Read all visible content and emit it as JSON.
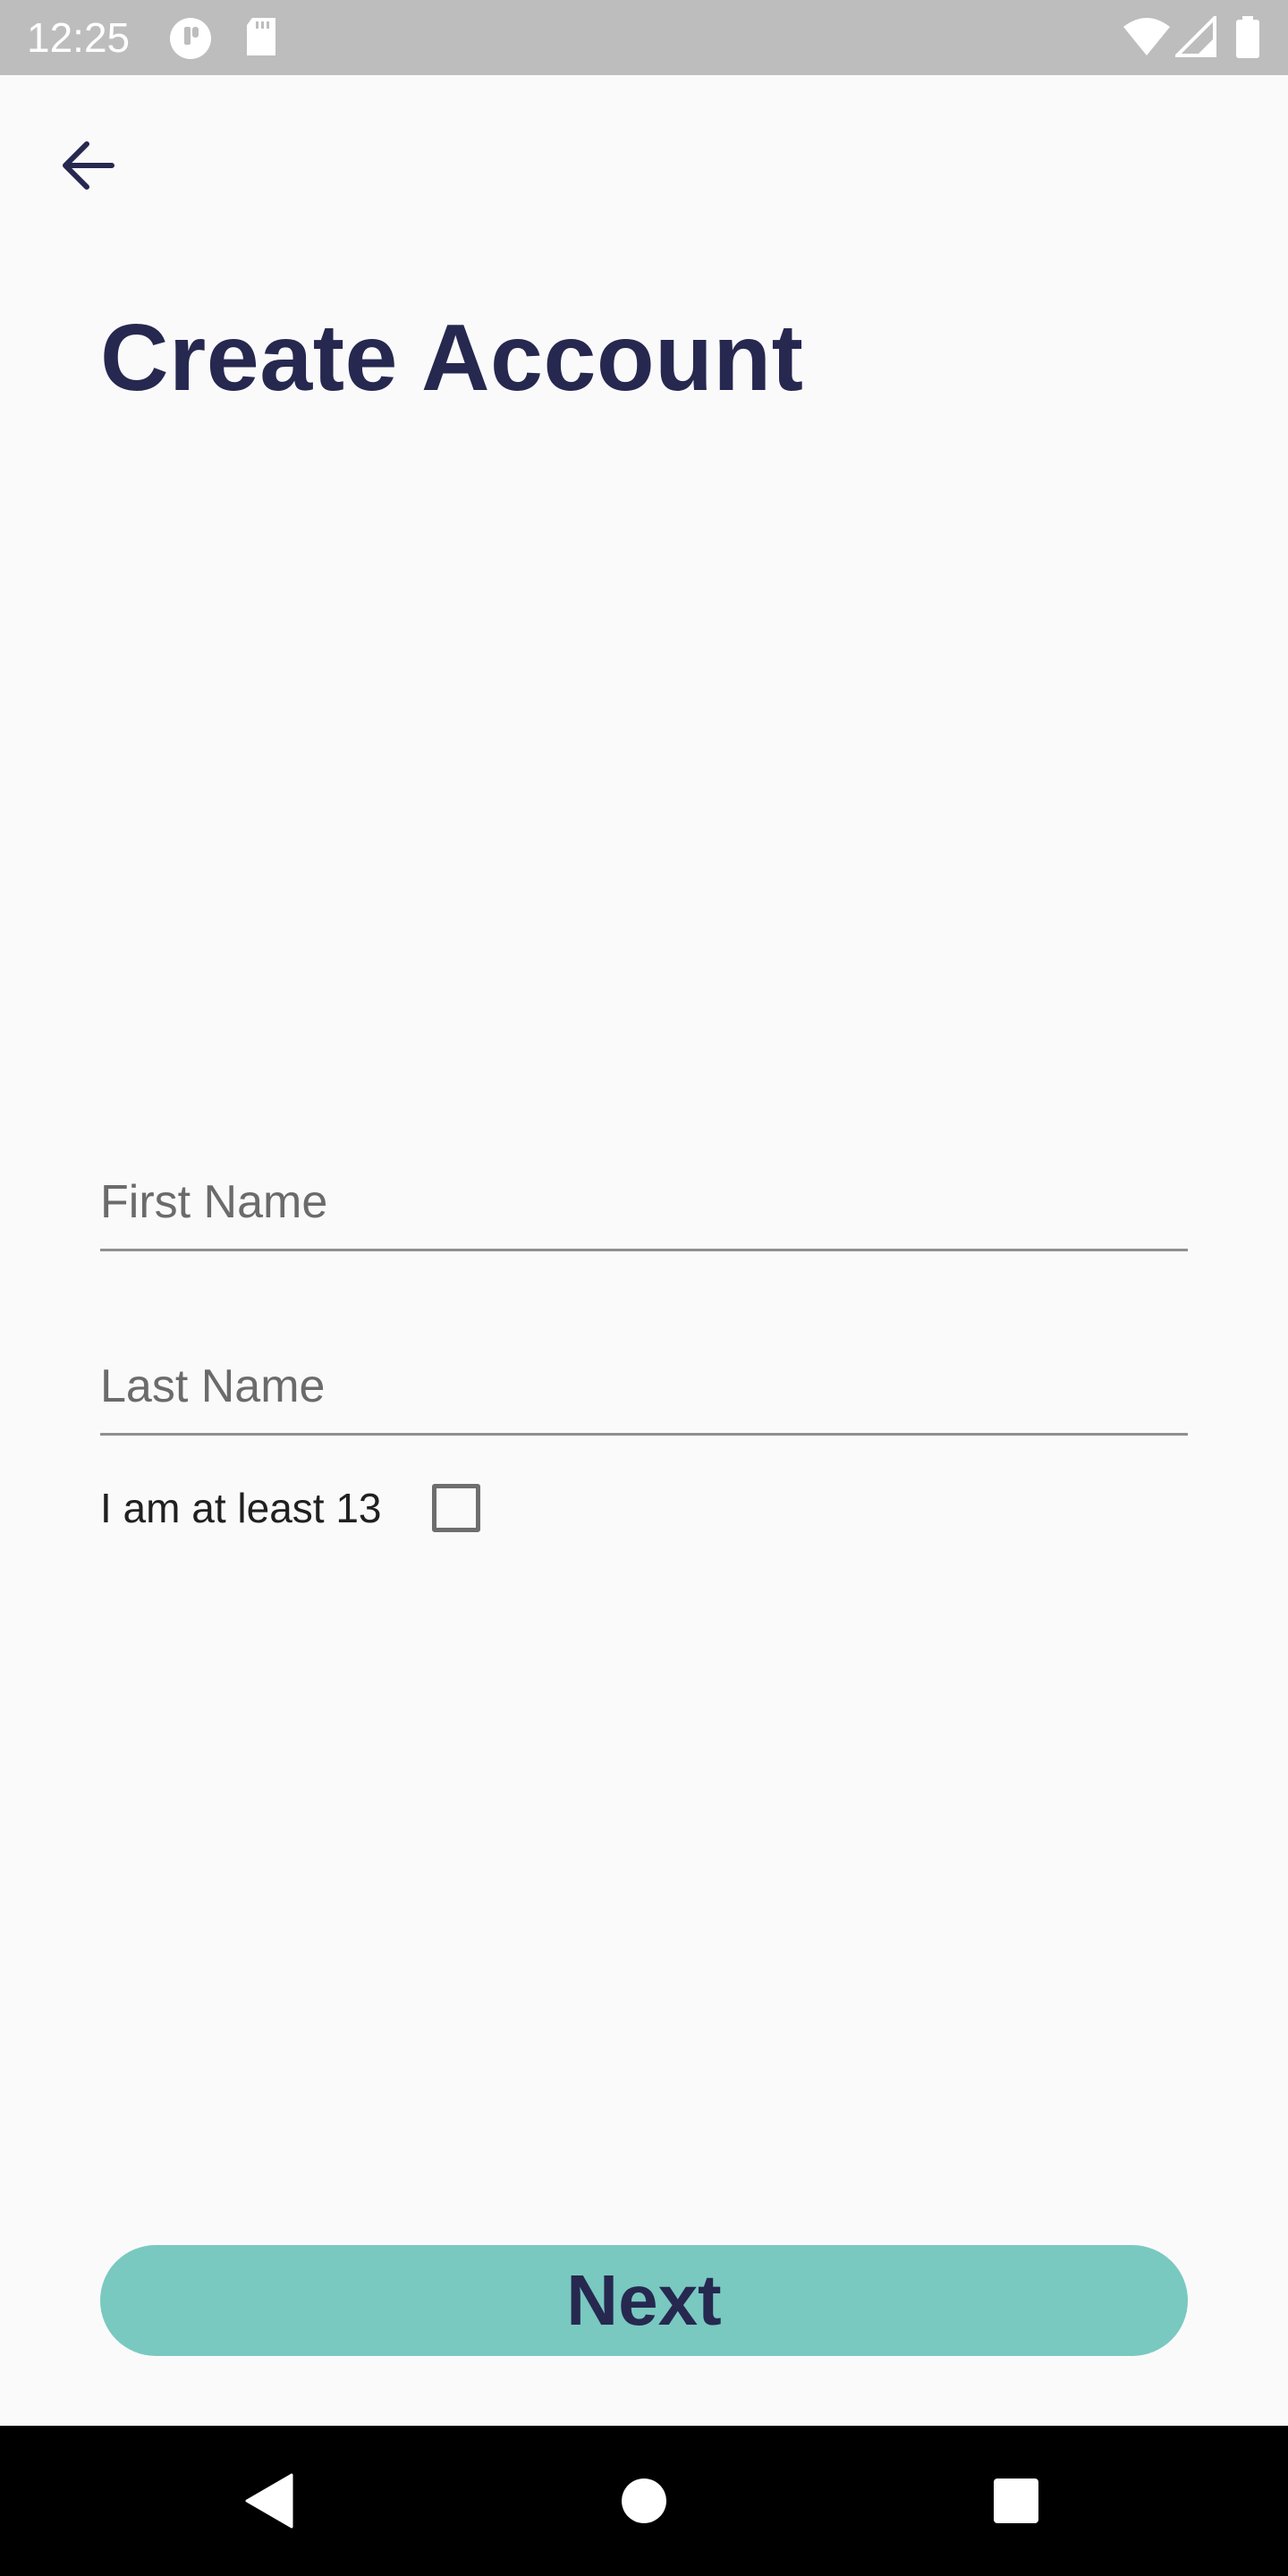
{
  "status_bar": {
    "time": "12:25",
    "icons": [
      "notification-icon",
      "sd-card-icon",
      "wifi-icon",
      "signal-icon",
      "battery-icon"
    ]
  },
  "header": {
    "back_icon": "arrow-back-icon",
    "title": "Create Account"
  },
  "form": {
    "first_name": {
      "placeholder": "First Name",
      "value": ""
    },
    "last_name": {
      "placeholder": "Last Name",
      "value": ""
    },
    "age_check": {
      "label": "I am at least 13",
      "checked": false
    }
  },
  "actions": {
    "next_label": "Next"
  },
  "nav_bar": {
    "icons": [
      "back-triangle-icon",
      "home-circle-icon",
      "recents-square-icon"
    ]
  },
  "colors": {
    "title": "#262850",
    "button": "#79c9c0",
    "status_bar": "#bdbdbd",
    "background": "#fafafa"
  }
}
